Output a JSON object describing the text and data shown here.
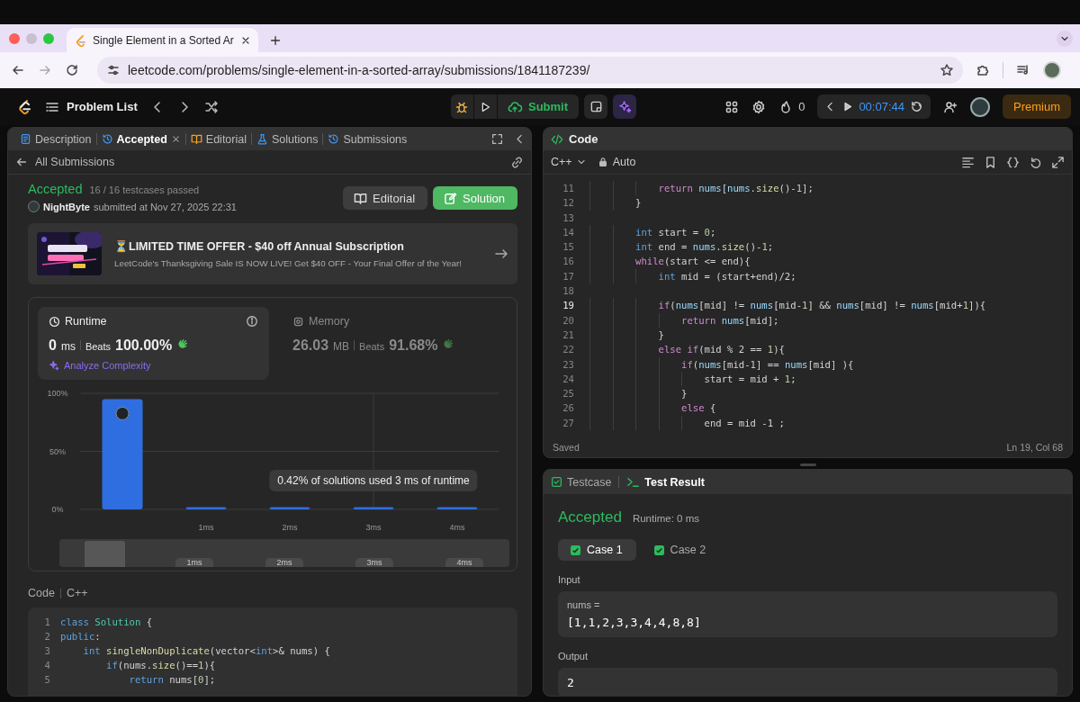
{
  "browser": {
    "tab": {
      "title": "Single Element in a Sorted Ar"
    },
    "address": "leetcode.com/problems/single-element-in-a-sorted-array/submissions/1841187239/"
  },
  "nav": {
    "problem_list": "Problem List",
    "submit": "Submit",
    "streak": "0",
    "timer": "00:07:44",
    "premium": "Premium"
  },
  "left_panel": {
    "tabs": [
      {
        "label": "Description",
        "selected": false,
        "closable": false,
        "kind": "description"
      },
      {
        "label": "Accepted",
        "selected": true,
        "closable": true,
        "kind": "history"
      },
      {
        "label": "Editorial",
        "selected": false,
        "closable": false,
        "kind": "book"
      },
      {
        "label": "Solutions",
        "selected": false,
        "closable": false,
        "kind": "flask"
      },
      {
        "label": "Submissions",
        "selected": false,
        "closable": false,
        "kind": "history"
      }
    ],
    "back_link": "All Submissions",
    "status": "Accepted",
    "testcases": "16 / 16 testcases passed",
    "user": "NightByte",
    "submitted": "submitted at Nov 27, 2025 22:31",
    "buttons": [
      {
        "label": "Editorial",
        "kind": "secondary"
      },
      {
        "label": "Solution",
        "kind": "primary"
      }
    ],
    "promo": {
      "title": "⏳LIMITED TIME OFFER - $40 off Annual Subscription",
      "text": "LeetCode's Thanksgiving Sale IS NOW LIVE! Get $40 OFF - Your Final Offer of the Year!"
    },
    "stats": [
      {
        "label": "Runtime",
        "value": "0",
        "unit": "ms",
        "beats_label": "Beats",
        "beats": "100.00%",
        "selected": true,
        "action": "Analyze Complexity"
      },
      {
        "label": "Memory",
        "value": "26.03",
        "unit": "MB",
        "beats_label": "Beats",
        "beats": "91.68%",
        "selected": false
      }
    ],
    "chart_data": {
      "type": "bar",
      "x": [
        0,
        1,
        2,
        3,
        4
      ],
      "values": [
        95,
        2,
        2,
        2,
        2
      ],
      "xlim": [
        -0.5,
        4.5
      ],
      "ylim": [
        0,
        100
      ],
      "yticks": [
        {
          "value": 0,
          "label": "0%"
        },
        {
          "value": 50,
          "label": "50%"
        },
        {
          "value": 100,
          "label": "100%"
        }
      ],
      "xticks": [
        {
          "value": 1,
          "label": "1ms"
        },
        {
          "value": 2,
          "label": "2ms"
        },
        {
          "value": 3,
          "label": "3ms"
        },
        {
          "value": 4,
          "label": "4ms"
        }
      ],
      "annotations": [
        "0.42% of solutions used 3 ms of runtime"
      ]
    },
    "navigator": {
      "labels": [
        "1ms",
        "2ms",
        "3ms",
        "4ms"
      ]
    },
    "code_header": {
      "label": "Code",
      "language": "C++"
    },
    "code": [
      {
        "number": "1",
        "tokens": [
          {
            "kind": "type",
            "text": "class"
          },
          {
            "kind": "cls",
            "text": " Solution"
          },
          {
            "kind": "plain",
            "text": " {"
          }
        ]
      },
      {
        "number": "2",
        "tokens": [
          {
            "kind": "type",
            "text": "public"
          },
          {
            "kind": "plain",
            "text": ":"
          }
        ]
      },
      {
        "number": "3",
        "tokens": [
          {
            "kind": "type",
            "text": "    int"
          },
          {
            "kind": "fn",
            "text": " singleNonDuplicate"
          },
          {
            "kind": "plain",
            "text": "(vector<"
          },
          {
            "kind": "type",
            "text": "int"
          },
          {
            "kind": "plain",
            "text": ">& nums) {"
          }
        ]
      },
      {
        "number": "4",
        "tokens": [
          {
            "kind": "type",
            "text": "        if"
          },
          {
            "kind": "plain",
            "text": "(nums."
          },
          {
            "kind": "fn",
            "text": "size"
          },
          {
            "kind": "plain",
            "text": "()=="
          },
          {
            "kind": "num",
            "text": "1"
          },
          {
            "kind": "plain",
            "text": "){"
          }
        ]
      },
      {
        "number": "5",
        "tokens": [
          {
            "kind": "type",
            "text": "            return"
          },
          {
            "kind": "plain",
            "text": " nums["
          },
          {
            "kind": "num",
            "text": "0"
          },
          {
            "kind": "plain",
            "text": "];"
          }
        ]
      }
    ]
  },
  "editor": {
    "title": "Code",
    "language": "C++",
    "mode": "Auto",
    "status": "Saved",
    "cursor": "Ln 19, Col 68",
    "lines": [
      {
        "number": "11",
        "current": false,
        "tokens": [
          {
            "kind": "kw",
            "text": "            return"
          },
          {
            "kind": "var",
            "text": " nums"
          },
          {
            "kind": "plain",
            "text": "["
          },
          {
            "kind": "var",
            "text": "nums"
          },
          {
            "kind": "plain",
            "text": "."
          },
          {
            "kind": "fn",
            "text": "size"
          },
          {
            "kind": "plain",
            "text": "()-"
          },
          {
            "kind": "num",
            "text": "1"
          },
          {
            "kind": "plain",
            "text": "];"
          }
        ]
      },
      {
        "number": "12",
        "current": false,
        "tokens": [
          {
            "kind": "plain",
            "text": "        }"
          }
        ]
      },
      {
        "number": "13",
        "current": false
      },
      {
        "number": "14",
        "current": false,
        "tokens": [
          {
            "kind": "type",
            "text": "        int"
          },
          {
            "kind": "plain",
            "text": " start = "
          },
          {
            "kind": "num",
            "text": "0"
          },
          {
            "kind": "plain",
            "text": ";"
          }
        ]
      },
      {
        "number": "15",
        "current": false,
        "tokens": [
          {
            "kind": "type",
            "text": "        int"
          },
          {
            "kind": "plain",
            "text": " end = "
          },
          {
            "kind": "var",
            "text": "nums"
          },
          {
            "kind": "plain",
            "text": "."
          },
          {
            "kind": "fn",
            "text": "size"
          },
          {
            "kind": "plain",
            "text": "()-"
          },
          {
            "kind": "num",
            "text": "1"
          },
          {
            "kind": "plain",
            "text": ";"
          }
        ]
      },
      {
        "number": "16",
        "current": false,
        "tokens": [
          {
            "kind": "kw",
            "text": "        while"
          },
          {
            "kind": "plain",
            "text": "(start <= end){"
          }
        ]
      },
      {
        "number": "17",
        "current": false,
        "tokens": [
          {
            "kind": "type",
            "text": "            int"
          },
          {
            "kind": "plain",
            "text": " mid = (start+end)/2;"
          }
        ]
      },
      {
        "number": "18",
        "current": false
      },
      {
        "number": "19",
        "current": true,
        "tokens": [
          {
            "kind": "kw",
            "text": "            if"
          },
          {
            "kind": "plain",
            "text": "("
          },
          {
            "kind": "var",
            "text": "nums"
          },
          {
            "kind": "plain",
            "text": "[mid] != "
          },
          {
            "kind": "var",
            "text": "nums"
          },
          {
            "kind": "plain",
            "text": "[mid-"
          },
          {
            "kind": "num",
            "text": "1"
          },
          {
            "kind": "plain",
            "text": "] && "
          },
          {
            "kind": "var",
            "text": "nums"
          },
          {
            "kind": "plain",
            "text": "[mid] != "
          },
          {
            "kind": "var",
            "text": "nums"
          },
          {
            "kind": "plain",
            "text": "[mid+"
          },
          {
            "kind": "num",
            "text": "1"
          },
          {
            "kind": "plain",
            "text": "]){"
          }
        ]
      },
      {
        "number": "20",
        "current": false,
        "tokens": [
          {
            "kind": "kw",
            "text": "                return"
          },
          {
            "kind": "var",
            "text": " nums"
          },
          {
            "kind": "plain",
            "text": "[mid];"
          }
        ]
      },
      {
        "number": "21",
        "current": false,
        "tokens": [
          {
            "kind": "plain",
            "text": "            }"
          }
        ]
      },
      {
        "number": "22",
        "current": false,
        "tokens": [
          {
            "kind": "kw",
            "text": "            else if"
          },
          {
            "kind": "plain",
            "text": "(mid % 2 == "
          },
          {
            "kind": "num",
            "text": "1"
          },
          {
            "kind": "plain",
            "text": "){"
          }
        ]
      },
      {
        "number": "23",
        "current": false,
        "tokens": [
          {
            "kind": "kw",
            "text": "                if"
          },
          {
            "kind": "plain",
            "text": "("
          },
          {
            "kind": "var",
            "text": "nums"
          },
          {
            "kind": "plain",
            "text": "[mid-"
          },
          {
            "kind": "num",
            "text": "1"
          },
          {
            "kind": "plain",
            "text": "] == "
          },
          {
            "kind": "var",
            "text": "nums"
          },
          {
            "kind": "plain",
            "text": "[mid] ){"
          }
        ]
      },
      {
        "number": "24",
        "current": false,
        "tokens": [
          {
            "kind": "plain",
            "text": "                    start = mid + "
          },
          {
            "kind": "num",
            "text": "1"
          },
          {
            "kind": "plain",
            "text": ";"
          }
        ]
      },
      {
        "number": "25",
        "current": false,
        "tokens": [
          {
            "kind": "plain",
            "text": "                }"
          }
        ]
      },
      {
        "number": "26",
        "current": false,
        "tokens": [
          {
            "kind": "kw",
            "text": "                else"
          },
          {
            "kind": "plain",
            "text": " {"
          }
        ]
      },
      {
        "number": "27",
        "current": false,
        "tokens": [
          {
            "kind": "plain",
            "text": "                    end = mid -1 ;"
          }
        ]
      }
    ]
  },
  "result": {
    "tabs": [
      {
        "label": "Testcase",
        "selected": false,
        "kind": "check"
      },
      {
        "label": "Test Result",
        "selected": true,
        "kind": "terminal"
      }
    ],
    "status": "Accepted",
    "runtime": "Runtime: 0 ms",
    "cases": [
      {
        "label": "Case 1",
        "selected": true,
        "passed": true
      },
      {
        "label": "Case 2",
        "selected": false,
        "passed": true
      }
    ],
    "input_label": "Input",
    "inputs": [
      {
        "name": "nums =",
        "value": "[1,1,2,3,3,4,4,8,8]"
      }
    ],
    "output_label": "Output",
    "output": "2"
  }
}
